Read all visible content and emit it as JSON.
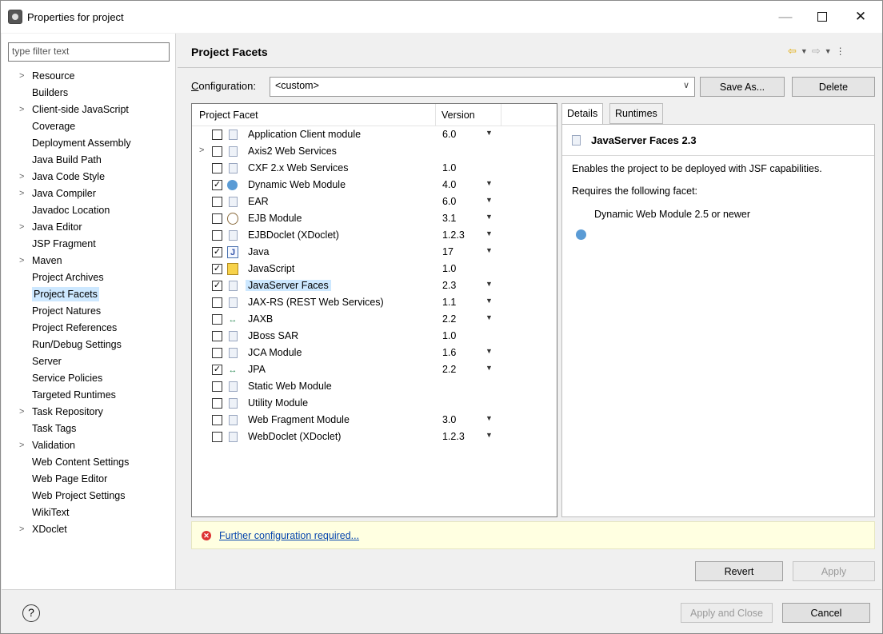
{
  "window": {
    "title": "Properties for project",
    "minimize": "—",
    "close": "✕"
  },
  "filter": {
    "placeholder": "type filter text"
  },
  "nav": [
    {
      "label": "Resource",
      "expandable": true
    },
    {
      "label": "Builders",
      "expandable": false
    },
    {
      "label": "Client-side JavaScript",
      "expandable": true
    },
    {
      "label": "Coverage",
      "expandable": false
    },
    {
      "label": "Deployment Assembly",
      "expandable": false
    },
    {
      "label": "Java Build Path",
      "expandable": false
    },
    {
      "label": "Java Code Style",
      "expandable": true
    },
    {
      "label": "Java Compiler",
      "expandable": true
    },
    {
      "label": "Javadoc Location",
      "expandable": false
    },
    {
      "label": "Java Editor",
      "expandable": true
    },
    {
      "label": "JSP Fragment",
      "expandable": false
    },
    {
      "label": "Maven",
      "expandable": true
    },
    {
      "label": "Project Archives",
      "expandable": false
    },
    {
      "label": "Project Facets",
      "expandable": false,
      "selected": true
    },
    {
      "label": "Project Natures",
      "expandable": false
    },
    {
      "label": "Project References",
      "expandable": false
    },
    {
      "label": "Run/Debug Settings",
      "expandable": false
    },
    {
      "label": "Server",
      "expandable": false
    },
    {
      "label": "Service Policies",
      "expandable": false
    },
    {
      "label": "Targeted Runtimes",
      "expandable": false
    },
    {
      "label": "Task Repository",
      "expandable": true
    },
    {
      "label": "Task Tags",
      "expandable": false
    },
    {
      "label": "Validation",
      "expandable": true
    },
    {
      "label": "Web Content Settings",
      "expandable": false
    },
    {
      "label": "Web Page Editor",
      "expandable": false
    },
    {
      "label": "Web Project Settings",
      "expandable": false
    },
    {
      "label": "WikiText",
      "expandable": false
    },
    {
      "label": "XDoclet",
      "expandable": true
    }
  ],
  "header": {
    "title": "Project Facets"
  },
  "config": {
    "label_prefix": "C",
    "label_rest": "onfiguration:",
    "value": "<custom>",
    "save_as": "Save As...",
    "delete": "Delete"
  },
  "facets_table": {
    "col_facet": "Project Facet",
    "col_version": "Version",
    "rows": [
      {
        "name": "Application Client module",
        "version": "6.0",
        "checked": false,
        "icon": "doc",
        "dropdown": true,
        "expandable": false
      },
      {
        "name": "Axis2 Web Services",
        "version": "",
        "checked": false,
        "icon": "doc",
        "dropdown": false,
        "expandable": true
      },
      {
        "name": "CXF 2.x Web Services",
        "version": "1.0",
        "checked": false,
        "icon": "doc",
        "dropdown": false,
        "expandable": false
      },
      {
        "name": "Dynamic Web Module",
        "version": "4.0",
        "checked": true,
        "icon": "globe",
        "dropdown": true,
        "expandable": false
      },
      {
        "name": "EAR",
        "version": "6.0",
        "checked": false,
        "icon": "doc",
        "dropdown": true,
        "expandable": false
      },
      {
        "name": "EJB Module",
        "version": "3.1",
        "checked": false,
        "icon": "bean",
        "dropdown": true,
        "expandable": false
      },
      {
        "name": "EJBDoclet (XDoclet)",
        "version": "1.2.3",
        "checked": false,
        "icon": "doc",
        "dropdown": true,
        "expandable": false
      },
      {
        "name": "Java",
        "version": "17",
        "checked": true,
        "icon": "java",
        "dropdown": true,
        "expandable": false
      },
      {
        "name": "JavaScript",
        "version": "1.0",
        "checked": true,
        "icon": "js",
        "dropdown": false,
        "expandable": false
      },
      {
        "name": "JavaServer Faces",
        "version": "2.3",
        "checked": true,
        "icon": "doc",
        "dropdown": true,
        "expandable": false,
        "highlight": true
      },
      {
        "name": "JAX-RS (REST Web Services)",
        "version": "1.1",
        "checked": false,
        "icon": "doc",
        "dropdown": true,
        "expandable": false
      },
      {
        "name": "JAXB",
        "version": "2.2",
        "checked": false,
        "icon": "arrows",
        "dropdown": true,
        "expandable": false
      },
      {
        "name": "JBoss SAR",
        "version": "1.0",
        "checked": false,
        "icon": "doc",
        "dropdown": false,
        "expandable": false
      },
      {
        "name": "JCA Module",
        "version": "1.6",
        "checked": false,
        "icon": "doc",
        "dropdown": true,
        "expandable": false
      },
      {
        "name": "JPA",
        "version": "2.2",
        "checked": true,
        "icon": "arrows",
        "dropdown": true,
        "expandable": false
      },
      {
        "name": "Static Web Module",
        "version": "",
        "checked": false,
        "icon": "doc",
        "dropdown": false,
        "expandable": false
      },
      {
        "name": "Utility Module",
        "version": "",
        "checked": false,
        "icon": "doc",
        "dropdown": false,
        "expandable": false
      },
      {
        "name": "Web Fragment Module",
        "version": "3.0",
        "checked": false,
        "icon": "doc",
        "dropdown": true,
        "expandable": false
      },
      {
        "name": "WebDoclet (XDoclet)",
        "version": "1.2.3",
        "checked": false,
        "icon": "doc",
        "dropdown": true,
        "expandable": false
      }
    ]
  },
  "details": {
    "tab_details": "Details",
    "tab_runtimes": "Runtimes",
    "title": "JavaServer Faces 2.3",
    "description": "Enables the project to be deployed with JSF capabilities.",
    "requires": "Requires the following facet:",
    "required_facet": "Dynamic Web Module 2.5 or newer"
  },
  "message": {
    "link": "Further configuration required..."
  },
  "buttons": {
    "revert": "Revert",
    "apply": "Apply",
    "apply_close": "Apply and Close",
    "cancel": "Cancel"
  },
  "colors": {
    "selection": "#cde8ff",
    "message_bg": "#ffffe1",
    "link": "#0645ad",
    "error": "#dd3333"
  }
}
